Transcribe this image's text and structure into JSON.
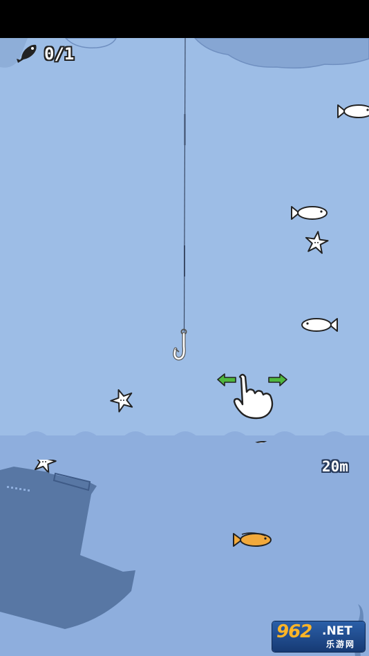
{
  "hud": {
    "catch_counter": "0/1",
    "depth": "20m"
  },
  "tutorial": {
    "gesture": "swipe-left-right",
    "hand_icon": "pointing-hand-icon",
    "arrow_color": "#4fb83e"
  },
  "scene": {
    "water_color": "#9dbde6",
    "deep_water_color": "#8eaedd",
    "silhouette_color": "#4f6d9a",
    "fish_color": "#ffffff",
    "goldfish_color": "#f2a93b"
  },
  "watermark": {
    "number": "962",
    "suffix": ".NET",
    "chinese": "乐游网"
  }
}
